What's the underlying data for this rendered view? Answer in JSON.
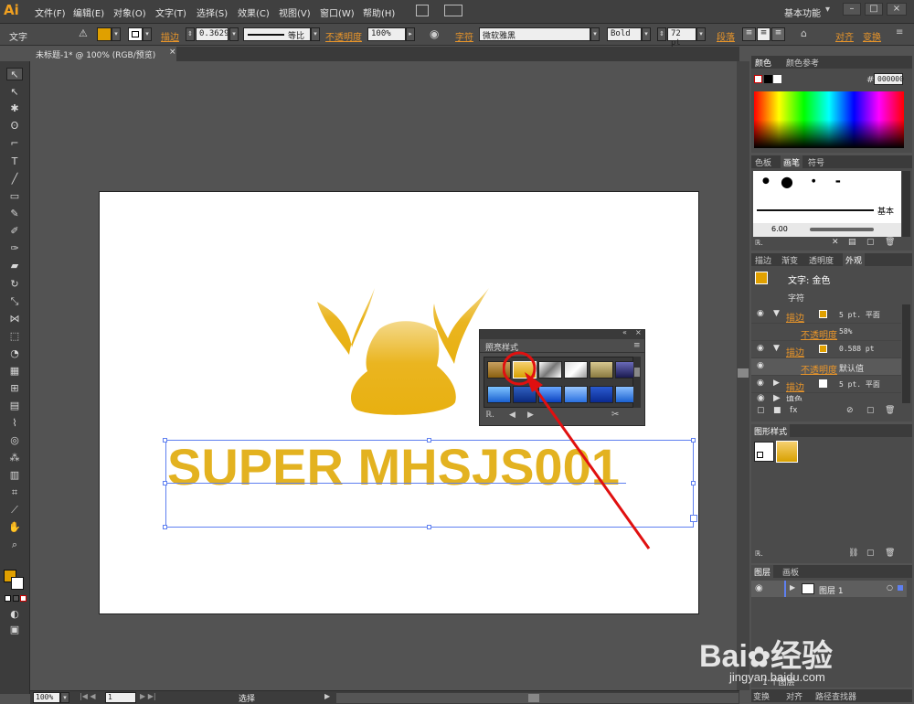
{
  "app": {
    "logo": "Ai",
    "workspace": "基本功能"
  },
  "menu": [
    "文件(F)",
    "编辑(E)",
    "对象(O)",
    "文字(T)",
    "选择(S)",
    "效果(C)",
    "视图(V)",
    "窗口(W)",
    "帮助(H)"
  ],
  "control": {
    "mode_label": "文字",
    "stroke_label": "描边",
    "stroke_value": "0.3629",
    "profile_label": "等比",
    "opacity_label": "不透明度",
    "opacity_value": "100%",
    "char_label": "字符",
    "font_family": "微软雅黑",
    "font_style": "Bold",
    "font_size": "72 pt",
    "paragraph_label": "段落",
    "align_label": "对齐",
    "transform_label": "变换",
    "fill_color": "#e0a000"
  },
  "document": {
    "tab_title": "未标题-1* @ 100% (RGB/预览)",
    "close": "×"
  },
  "canvas": {
    "headline": "SUPER MHSJS001"
  },
  "style_panel": {
    "title": "照亮样式",
    "selected_index": 1
  },
  "color_panel": {
    "tabs": [
      "颜色",
      "颜色参考"
    ],
    "hex_label": "#",
    "hex_value": "000000"
  },
  "brush_panel": {
    "tabs": [
      "色板",
      "画笔",
      "符号"
    ],
    "basic_label": "基本",
    "size_value": "6.00"
  },
  "appearance_panel": {
    "tabs": [
      "描边",
      "渐变",
      "透明度",
      "外观"
    ],
    "title": "文字: 金色",
    "char": "字符",
    "rows": [
      {
        "label": "描边",
        "value": "5 pt. 平面"
      },
      {
        "label": "不透明度",
        "value": "58%"
      },
      {
        "label": "描边",
        "value": "0.588 pt"
      },
      {
        "label": "不透明度",
        "value": "默认值"
      },
      {
        "label": "描边",
        "value": "5 pt. 平面"
      },
      {
        "label": "填色",
        "value": ""
      }
    ]
  },
  "graphic_styles_panel": {
    "title": "图形样式"
  },
  "layers_panel": {
    "tabs": [
      "图层",
      "画板"
    ],
    "layer_name": "图层 1",
    "count": "1 个图层"
  },
  "bottom_panel": {
    "tabs": [
      "变换",
      "对齐",
      "路径查找器"
    ]
  },
  "status": {
    "zoom": "100%",
    "page": "1",
    "tool": "选择"
  },
  "watermark": {
    "brand": "Bai",
    "brand2": "经验",
    "url": "jingyan.baidu.com"
  }
}
